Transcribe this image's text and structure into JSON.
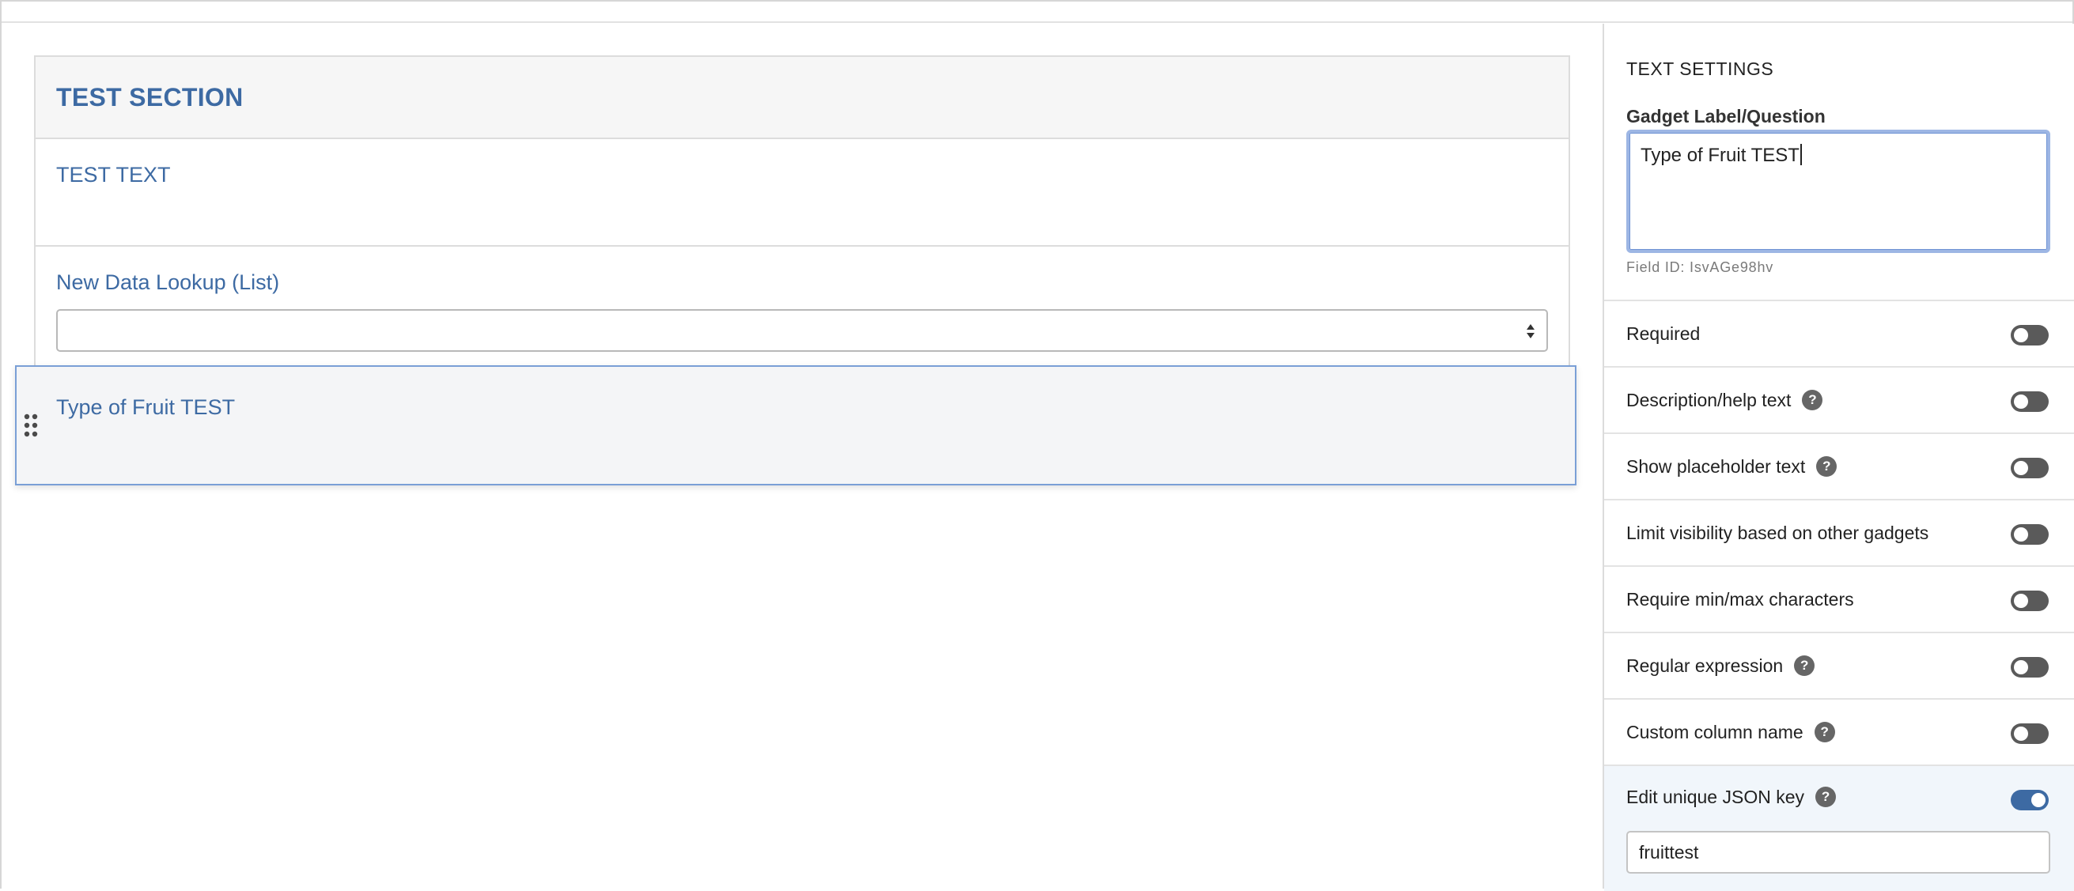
{
  "canvas": {
    "section_title": "TEST SECTION",
    "text_gadget_label": "TEST TEXT",
    "lookup_gadget_label": "New Data Lookup (List)",
    "lookup_select_value": "",
    "dragged_gadget_label": "Type of Fruit TEST"
  },
  "panel": {
    "title": "TEXT SETTINGS",
    "label_field": {
      "label": "Gadget Label/Question",
      "value": "Type of Fruit TEST",
      "field_id": "Field ID: IsvAGe98hv"
    },
    "options": [
      {
        "label": "Required",
        "help": false,
        "enabled": false
      },
      {
        "label": "Description/help text",
        "help": true,
        "enabled": false
      },
      {
        "label": "Show placeholder text",
        "help": true,
        "enabled": false
      },
      {
        "label": "Limit visibility based on other gadgets",
        "help": false,
        "enabled": false
      },
      {
        "label": "Require min/max characters",
        "help": false,
        "enabled": false
      },
      {
        "label": "Regular expression",
        "help": true,
        "enabled": false
      },
      {
        "label": "Custom column name",
        "help": true,
        "enabled": false
      },
      {
        "label": "Edit unique JSON key",
        "help": true,
        "enabled": true
      }
    ],
    "json_key_value": "fruittest",
    "help_glyph": "?"
  },
  "colors": {
    "accent": "#3d6aa3",
    "toggle_off": "#5a5a5a",
    "help_icon": "#666666",
    "focus_border": "#9db6e4"
  }
}
